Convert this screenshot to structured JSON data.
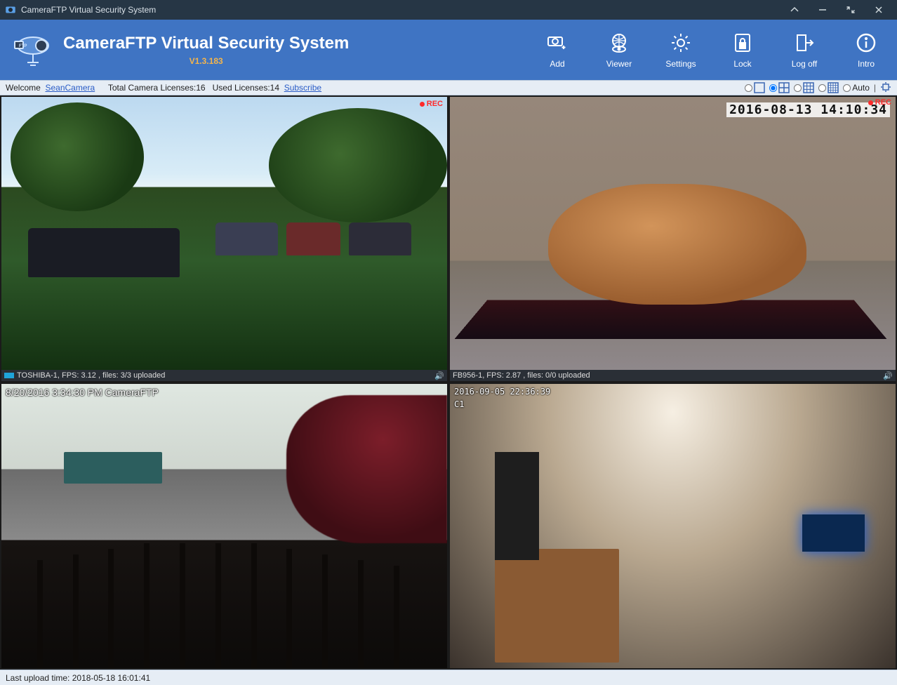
{
  "titlebar": {
    "title": "CameraFTP Virtual Security System"
  },
  "header": {
    "app_title": "CameraFTP Virtual Security System",
    "version": "V1.3.183",
    "buttons": {
      "add": "Add",
      "viewer": "Viewer",
      "settings": "Settings",
      "lock": "Lock",
      "logoff": "Log off",
      "intro": "Intro"
    }
  },
  "infobar": {
    "welcome_label": "Welcome",
    "username": "SeanCamera",
    "total_licenses_label": "Total Camera Licenses:",
    "total_licenses_value": "16",
    "used_licenses_label": "Used Licenses:",
    "used_licenses_value": "14",
    "subscribe": "Subscribe",
    "auto_label": "Auto"
  },
  "cameras": {
    "pane1": {
      "rec": "REC",
      "status": "TOSHIBA-1, FPS: 3.12 , files: 3/3 uploaded"
    },
    "pane2": {
      "rec": "REC",
      "overlay_ts": "2016-08-13 14:10:34",
      "status": "FB956-1, FPS: 2.87 , files: 0/0 uploaded"
    },
    "pane3": {
      "overlay_ts": "8/20/2016 3:34:30 PM CameraFTP"
    },
    "pane4": {
      "overlay_ts": "2016-09-05 22:36:39",
      "overlay_id": "C1"
    }
  },
  "statusbar": {
    "last_upload_label": "Last upload time:",
    "last_upload_value": "2018-05-18 16:01:41"
  }
}
